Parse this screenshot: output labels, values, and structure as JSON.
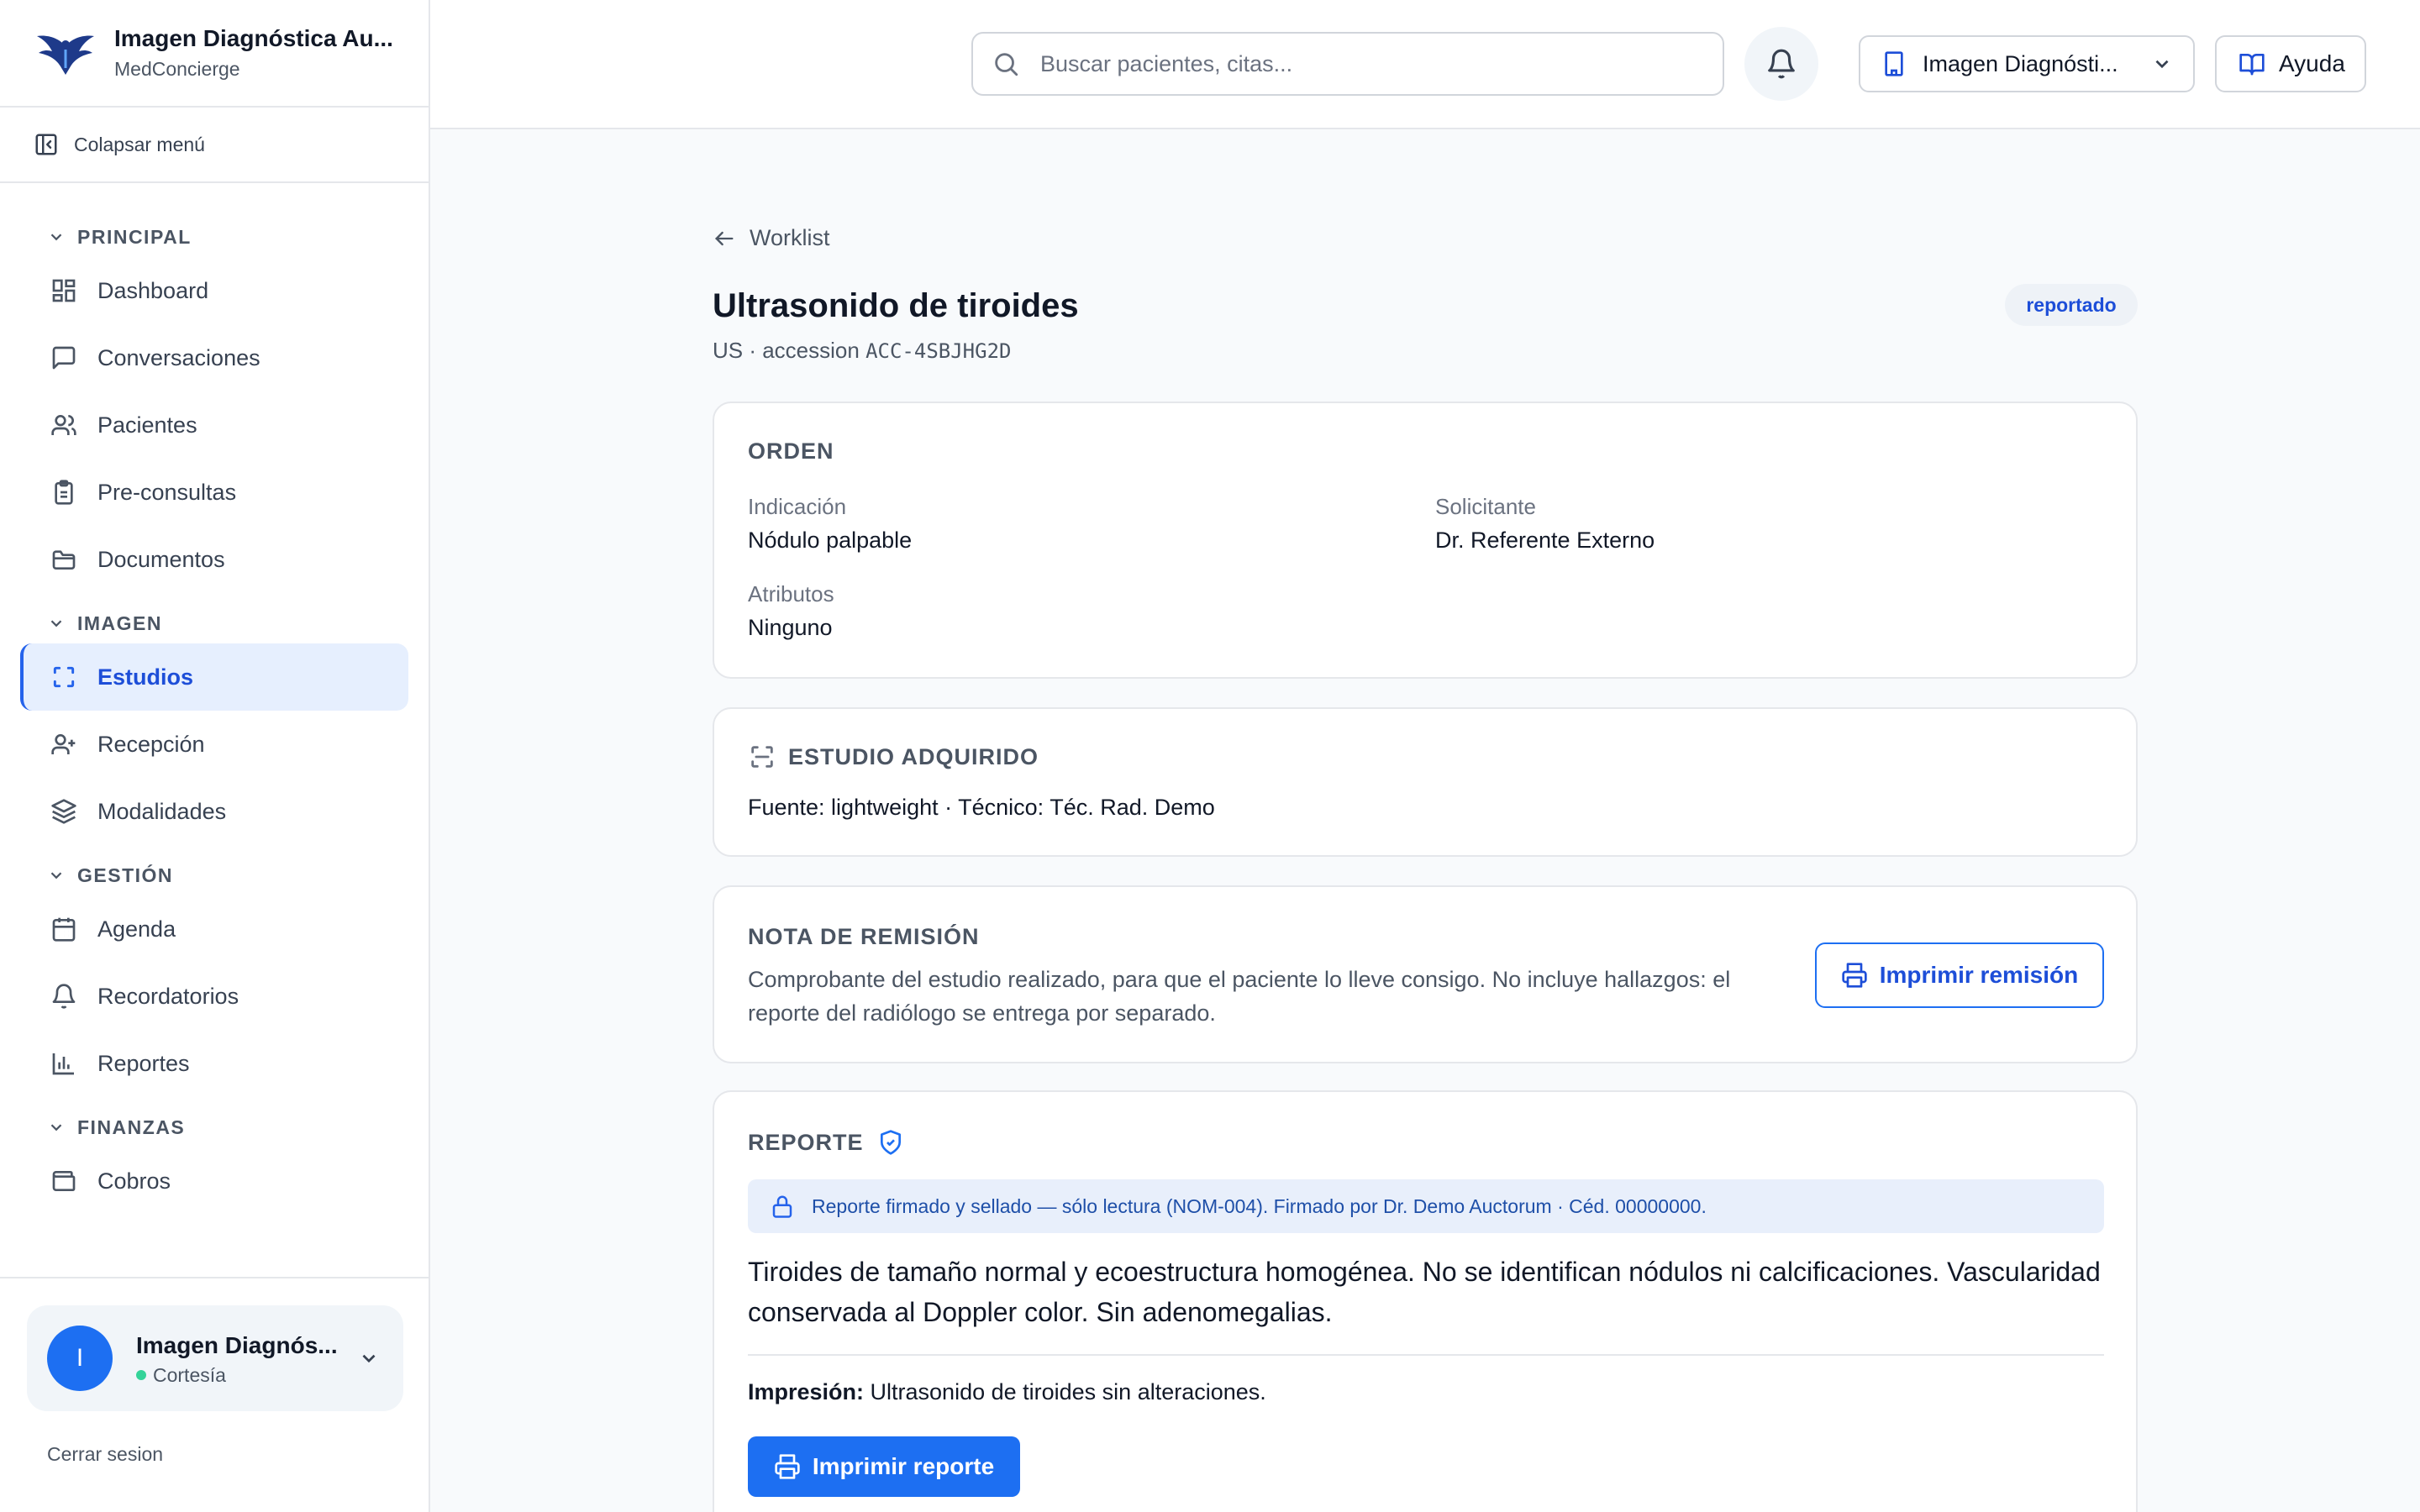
{
  "app": {
    "title": "Imagen Diagnóstica Au...",
    "subtitle": "MedConcierge"
  },
  "sidebar": {
    "collapse_label": "Colapsar menú",
    "sections": [
      {
        "title": "PRINCIPAL",
        "items": [
          {
            "label": "Dashboard",
            "icon": "dashboard-icon"
          },
          {
            "label": "Conversaciones",
            "icon": "chat-icon"
          },
          {
            "label": "Pacientes",
            "icon": "users-icon"
          },
          {
            "label": "Pre-consultas",
            "icon": "clipboard-icon"
          },
          {
            "label": "Documentos",
            "icon": "folder-icon"
          }
        ]
      },
      {
        "title": "IMAGEN",
        "items": [
          {
            "label": "Estudios",
            "icon": "scan-icon",
            "active": true
          },
          {
            "label": "Recepción",
            "icon": "user-plus-icon"
          },
          {
            "label": "Modalidades",
            "icon": "layers-icon"
          }
        ]
      },
      {
        "title": "GESTIÓN",
        "items": [
          {
            "label": "Agenda",
            "icon": "calendar-icon"
          },
          {
            "label": "Recordatorios",
            "icon": "bell-icon"
          },
          {
            "label": "Reportes",
            "icon": "bar-chart-icon"
          }
        ]
      },
      {
        "title": "FINANZAS",
        "items": [
          {
            "label": "Cobros",
            "icon": "wallet-icon"
          }
        ]
      }
    ],
    "user": {
      "initial": "I",
      "name": "Imagen Diagnós...",
      "plan": "Cortesía"
    },
    "logout_label": "Cerrar sesion"
  },
  "header": {
    "search_placeholder": "Buscar pacientes, citas...",
    "org_label": "Imagen Diagnósti...",
    "help_label": "Ayuda"
  },
  "study": {
    "back_label": "Worklist",
    "title": "Ultrasonido de tiroides",
    "modality": "US · accession ",
    "accession": "ACC-4SBJHG2D",
    "status": "reportado"
  },
  "order": {
    "title": "ORDEN",
    "indicacion_label": "Indicación",
    "indicacion_value": "Nódulo palpable",
    "solicitante_label": "Solicitante",
    "solicitante_value": "Dr. Referente Externo",
    "atributos_label": "Atributos",
    "atributos_value": "Ninguno"
  },
  "acquired": {
    "title": "ESTUDIO ADQUIRIDO",
    "details": "Fuente: lightweight · Técnico: Téc. Rad. Demo"
  },
  "referral": {
    "title": "NOTA DE REMISIÓN",
    "text": "Comprobante del estudio realizado, para que el paciente lo lleve consigo. No incluye hallazgos: el reporte del radiólogo se entrega por separado.",
    "button_label": "Imprimir remisión"
  },
  "report": {
    "title": "REPORTE",
    "sealed_notice": "Reporte firmado y sellado — sólo lectura (NOM-004). Firmado por Dr. Demo Auctorum · Céd. 00000000.",
    "findings": "Tiroides de tamaño normal y ecoestructura homogénea. No se identifican nódulos ni calcificaciones. Vascularidad conservada al Doppler color. Sin adenomegalias.",
    "impression_label": "Impresión:",
    "impression_value": " Ultrasonido de tiroides sin alteraciones.",
    "button_label": "Imprimir reporte"
  },
  "colors": {
    "accent": "#1d6ff2",
    "active_bg": "#e6effe",
    "status_online": "#34d399"
  }
}
